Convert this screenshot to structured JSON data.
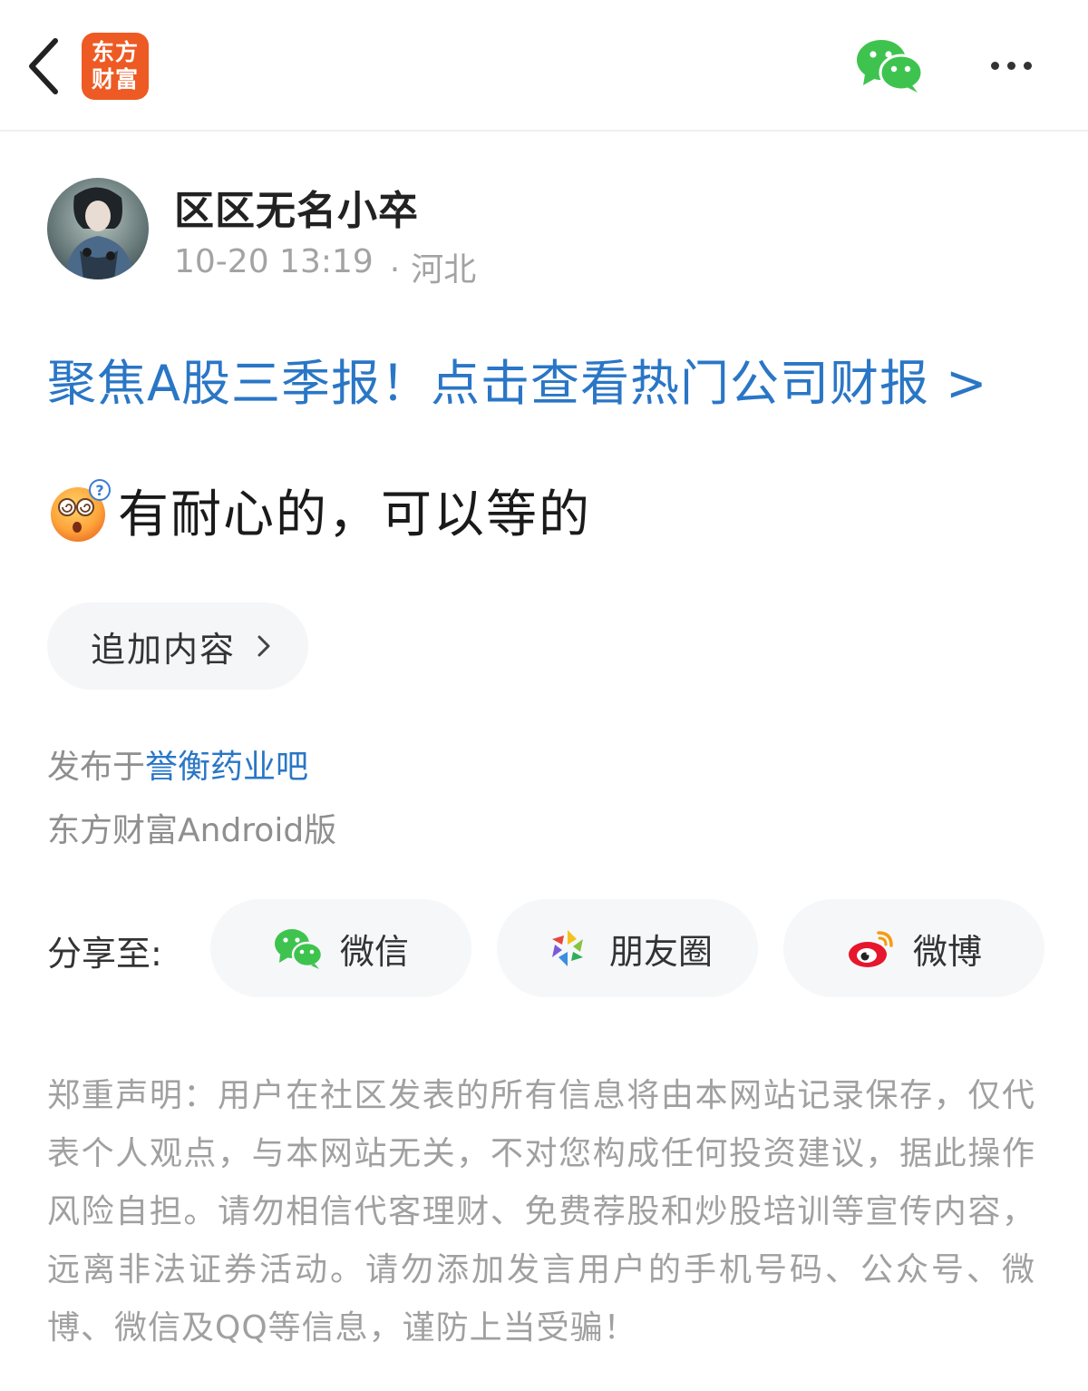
{
  "header": {
    "back_icon": "chevron-left-icon",
    "logo_line1": "东方",
    "logo_line2": "财富",
    "share_icon": "wechat-icon",
    "more_icon": "more-dots-icon",
    "logo_color": "#ee5a24"
  },
  "author": {
    "name": "区区无名小卒",
    "time": "10-20 13:19",
    "location": "河北"
  },
  "promo_banner": "聚焦A股三季报！点击查看热门公司财报 >",
  "post": {
    "emoji": "thinking-dizzy-emoji",
    "text": "有耐心的，可以等的"
  },
  "append_button": {
    "label": "追加内容",
    "icon": "chevron-right-icon"
  },
  "published": {
    "prefix": "发布于",
    "bar_name": "誉衡药业吧"
  },
  "client": "东方财富Android版",
  "share": {
    "label": "分享至:",
    "targets": [
      {
        "label": "微信",
        "icon": "wechat-icon"
      },
      {
        "label": "朋友圈",
        "icon": "moments-icon"
      },
      {
        "label": "微博",
        "icon": "weibo-icon"
      }
    ]
  },
  "disclaimer": "郑重声明：用户在社区发表的所有信息将由本网站记录保存，仅代表个人观点，与本网站无关，不对您构成任何投资建议，据此操作风险自担。请勿相信代客理财、免费荐股和炒股培训等宣传内容，远离非法证券活动。请勿添加发言用户的手机号码、公众号、微博、微信及QQ等信息，谨防上当受骗！",
  "colors": {
    "link_blue": "#2a76c6",
    "wechat_green": "#3ec34f",
    "muted_text": "#a0a0a0"
  }
}
